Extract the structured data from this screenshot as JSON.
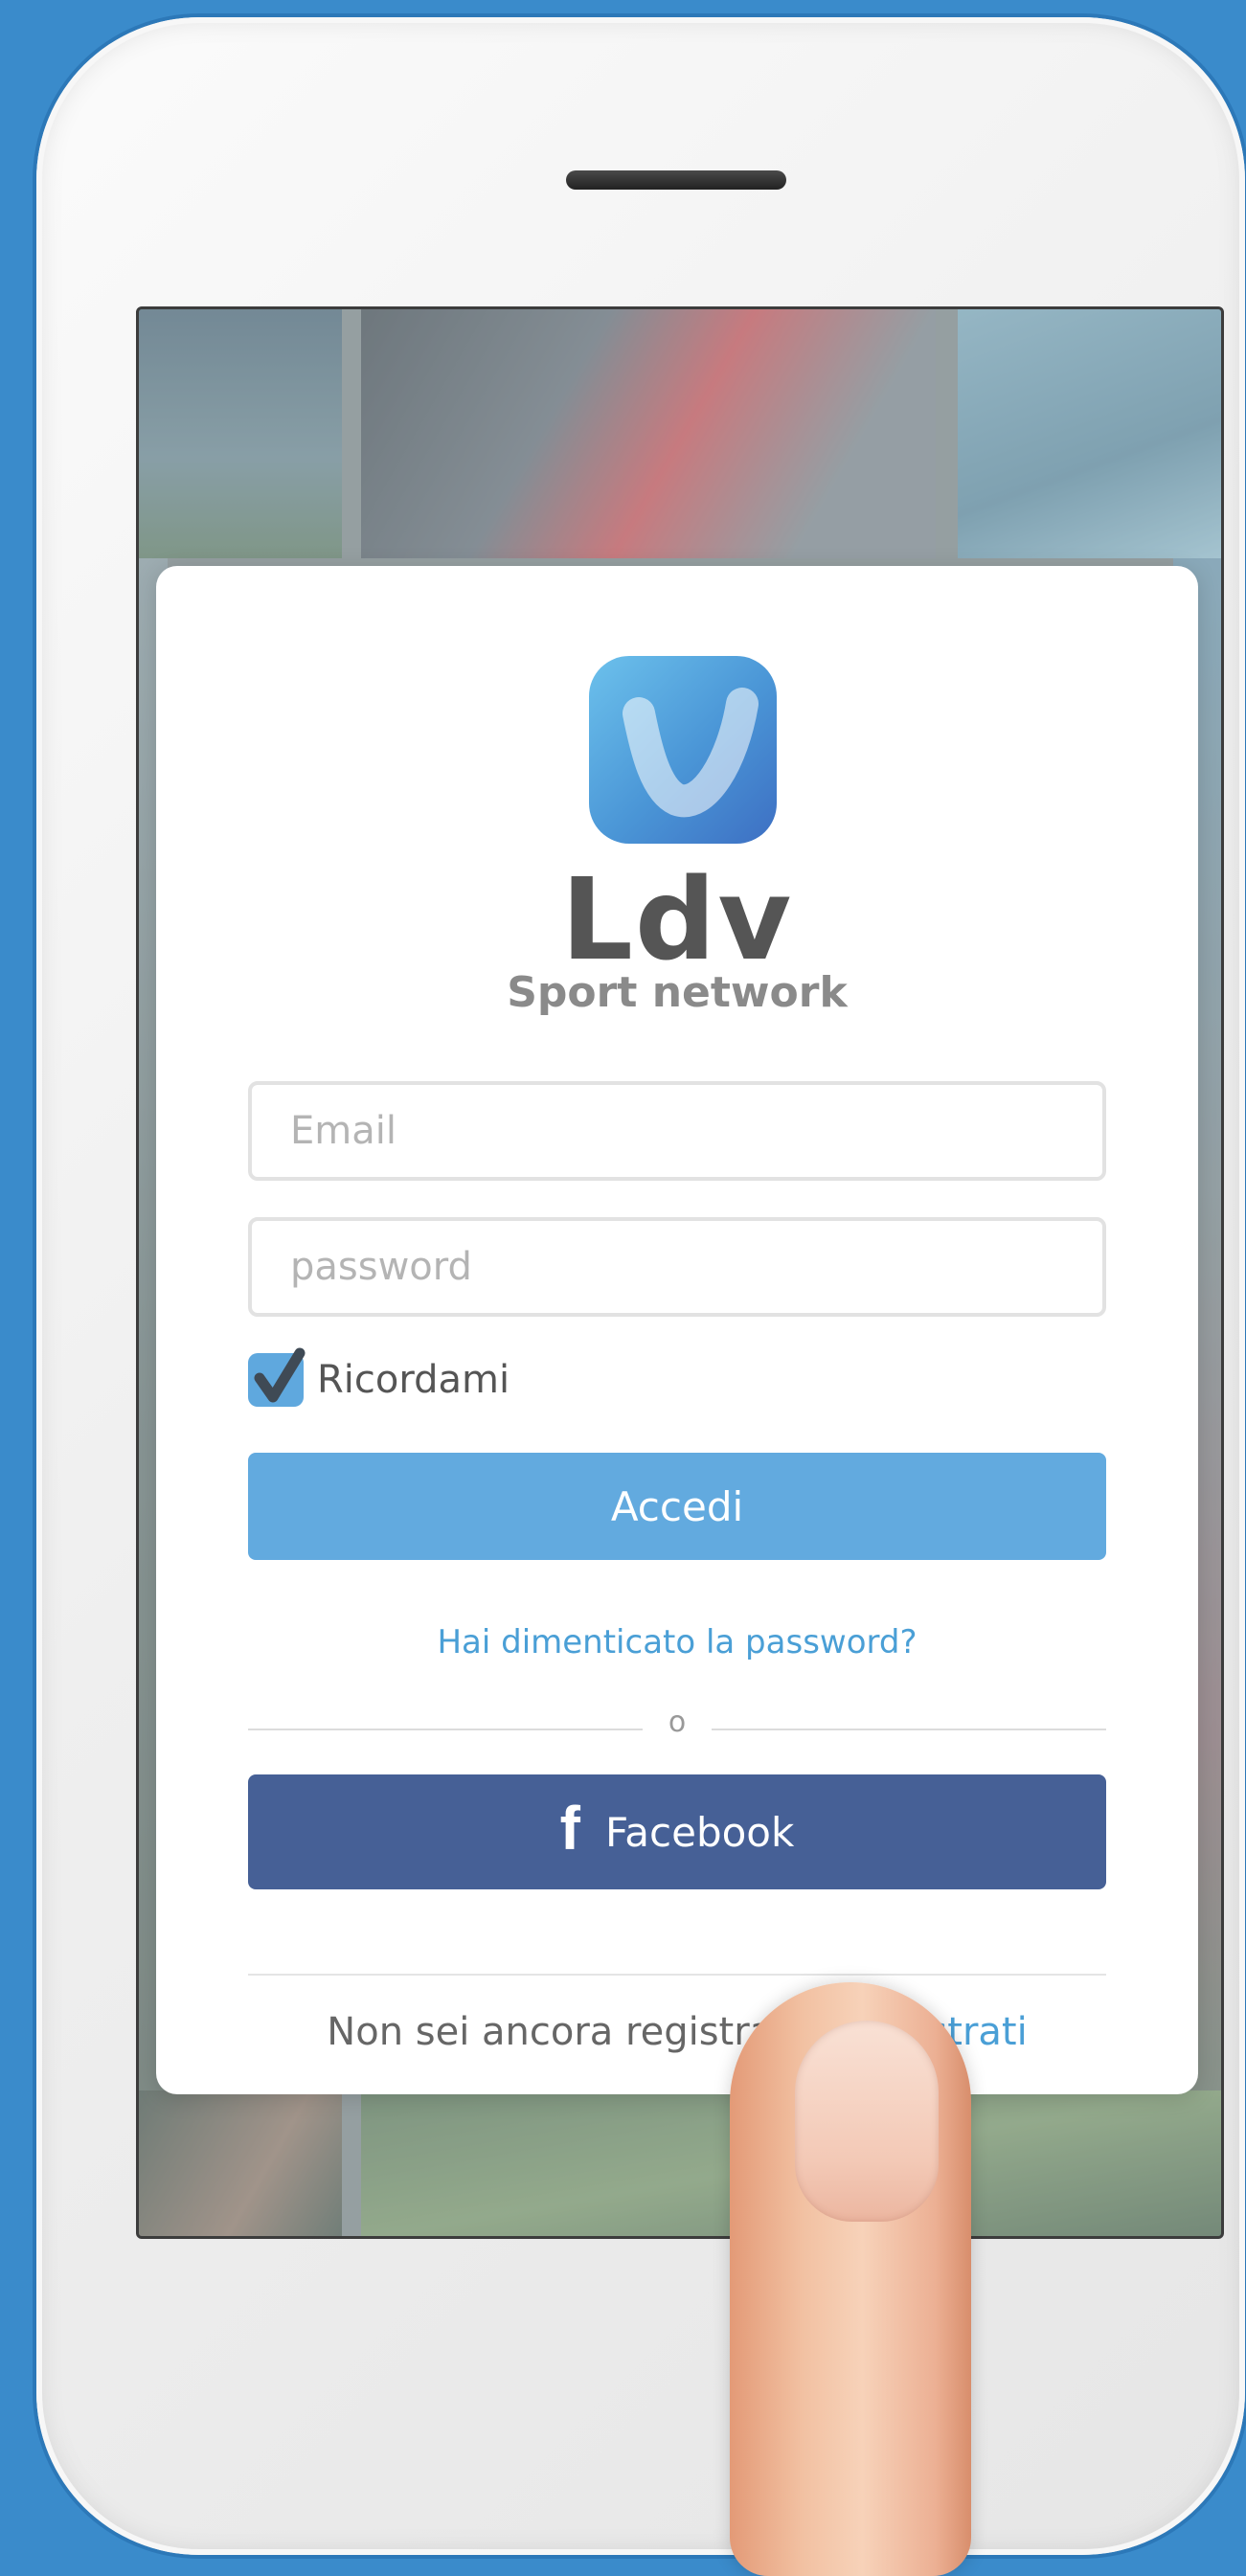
{
  "app": {
    "name": "Ldv",
    "tagline": "Sport network"
  },
  "form": {
    "email_placeholder": "Email",
    "password_placeholder": "password",
    "remember_label": "Ricordami",
    "remember_checked": true,
    "login_button": "Accedi",
    "forgot_link": "Hai dimenticato la password?",
    "or_label": "o",
    "facebook_button": "Facebook",
    "facebook_icon": "f",
    "signup_prompt": "Non sei ancora registrato?",
    "signup_link": "Registrati"
  },
  "colors": {
    "page_background": "#3a8bcb",
    "login_button": "#62aadf",
    "facebook_button": "#466096",
    "link": "#4a9fd6",
    "checkbox": "#5fa8de"
  }
}
